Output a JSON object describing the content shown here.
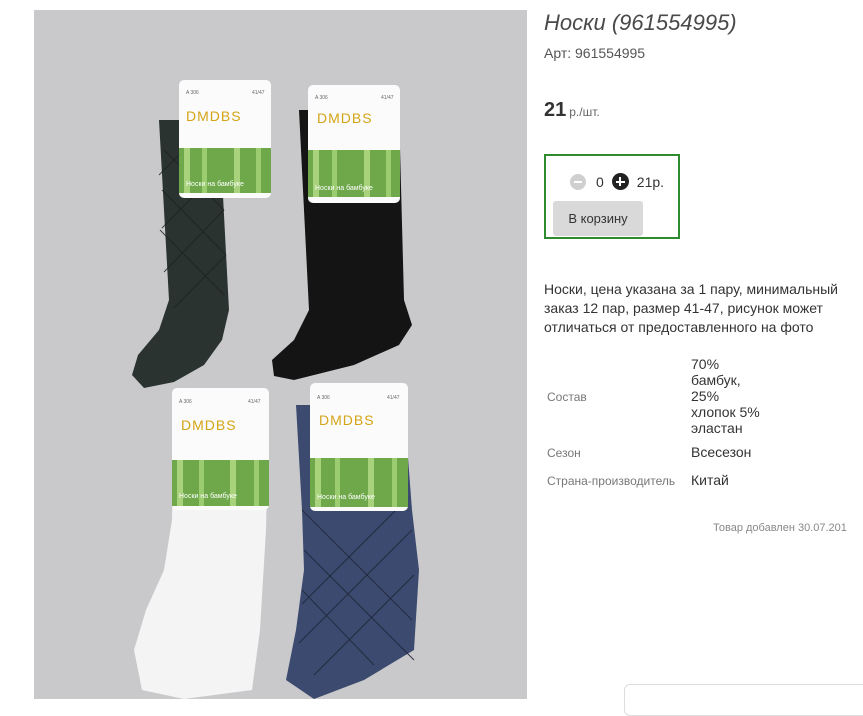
{
  "product": {
    "title": "Носки (961554995)",
    "article": "Арт: 961554995",
    "price": "21",
    "price_unit": "р./шт.",
    "description": "Носки, цена указана за 1 пару, минимальный заказ 12 пар, размер 41-47, рисунок может отличаться от предоставленного на фото",
    "added": "Товар добавлен 30.07.201"
  },
  "cart": {
    "quantity": "0",
    "sum": "21р.",
    "button_label": "В корзину"
  },
  "properties": [
    {
      "name": "Состав",
      "value_lines": [
        "70%",
        "бамбук,",
        "25%",
        "хлопок 5%",
        "эластан"
      ]
    },
    {
      "name": "Сезон",
      "value_lines": [
        "Всесезон"
      ]
    },
    {
      "name": "Страна-производитель",
      "value_lines": [
        "Китай"
      ]
    }
  ],
  "photo": {
    "brand": "DMDBS",
    "tag_caption": "Носки на бамбуке",
    "tag_code": "A 306",
    "tag_size": "41/47",
    "sock_colors": [
      "#2a3330",
      "#141414",
      "#f4f4f4",
      "#3b4a6e"
    ]
  }
}
